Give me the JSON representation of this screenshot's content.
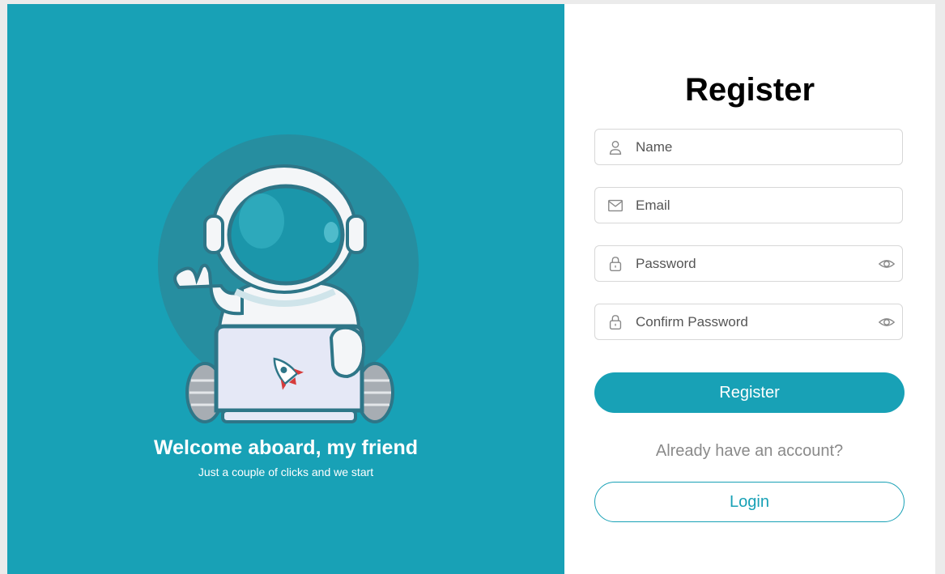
{
  "hero": {
    "welcome": "Welcome aboard, my friend",
    "subtitle": "Just a couple of clicks and we start"
  },
  "form": {
    "title": "Register",
    "fields": [
      {
        "placeholder": "Name",
        "icon": "user-icon"
      },
      {
        "placeholder": "Email",
        "icon": "mail-icon"
      },
      {
        "placeholder": "Password",
        "icon": "lock-icon",
        "toggle_icon": "eye-icon"
      },
      {
        "placeholder": "Confirm Password",
        "icon": "lock-icon",
        "toggle_icon": "eye-icon"
      }
    ],
    "register_label": "Register",
    "already_text": "Already have an account?",
    "login_label": "Login"
  },
  "colors": {
    "accent": "#18a1b6",
    "background": "#ebebeb",
    "panel": "#ffffff"
  }
}
